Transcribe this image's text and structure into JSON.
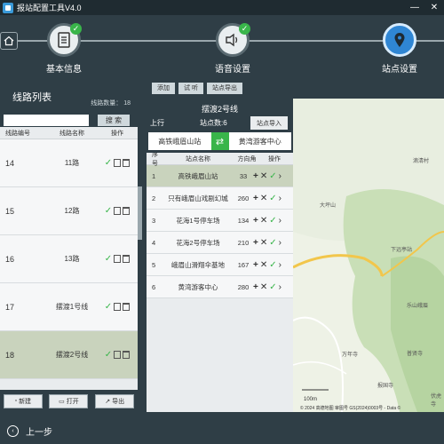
{
  "window": {
    "title": "报站配置工具V4.0"
  },
  "steps": [
    {
      "label": "基本信息"
    },
    {
      "label": "语音设置"
    },
    {
      "label": "站点设置"
    }
  ],
  "route_list": {
    "title": "线路列表",
    "count_label": "线路数量：",
    "count": "18",
    "search_button": "搜 索",
    "columns": [
      "线路编号",
      "线路名称",
      "操作"
    ],
    "rows": [
      {
        "id": "14",
        "name": "11路"
      },
      {
        "id": "15",
        "name": "12路"
      },
      {
        "id": "16",
        "name": "13路"
      },
      {
        "id": "17",
        "name": "摆渡1号线"
      },
      {
        "id": "18",
        "name": "摆渡2号线"
      }
    ],
    "footer": {
      "new": "新建",
      "open": "打开",
      "export": "导出"
    }
  },
  "toolbar": {
    "add": "添加",
    "listen": "试 听",
    "export_station": "站点导出"
  },
  "station_panel": {
    "route_name": "摆渡2号线",
    "direction": "上行",
    "station_count": "站点数:6",
    "import_button": "站点导入",
    "start_station": "高铁峨眉山站",
    "end_station": "黄湾游客中心",
    "columns": [
      "序号",
      "站点名称",
      "方向角",
      "操作"
    ],
    "rows": [
      {
        "idx": "1",
        "name": "高铁峨眉山站",
        "angle": "33"
      },
      {
        "idx": "2",
        "name": "只有峨眉山戏剧幻城",
        "angle": "260"
      },
      {
        "idx": "3",
        "name": "花海1号停车场",
        "angle": "134"
      },
      {
        "idx": "4",
        "name": "花海2号停车场",
        "angle": "210"
      },
      {
        "idx": "5",
        "name": "峨眉山滑翔伞基地",
        "angle": "167"
      },
      {
        "idx": "6",
        "name": "黄湾游客中心",
        "angle": "280"
      }
    ]
  },
  "map": {
    "labels": [
      "大坪山",
      "下远亭站",
      "乐山峨眉",
      "滴清村",
      "万年寺",
      "报国寺",
      "伏虎寺",
      "普贤寺"
    ],
    "scale": "100m",
    "copyright": "© 2024 高德地图 审图号 GS(2024)0003号 - Data ©"
  },
  "bottom": {
    "prev": "上一步"
  }
}
